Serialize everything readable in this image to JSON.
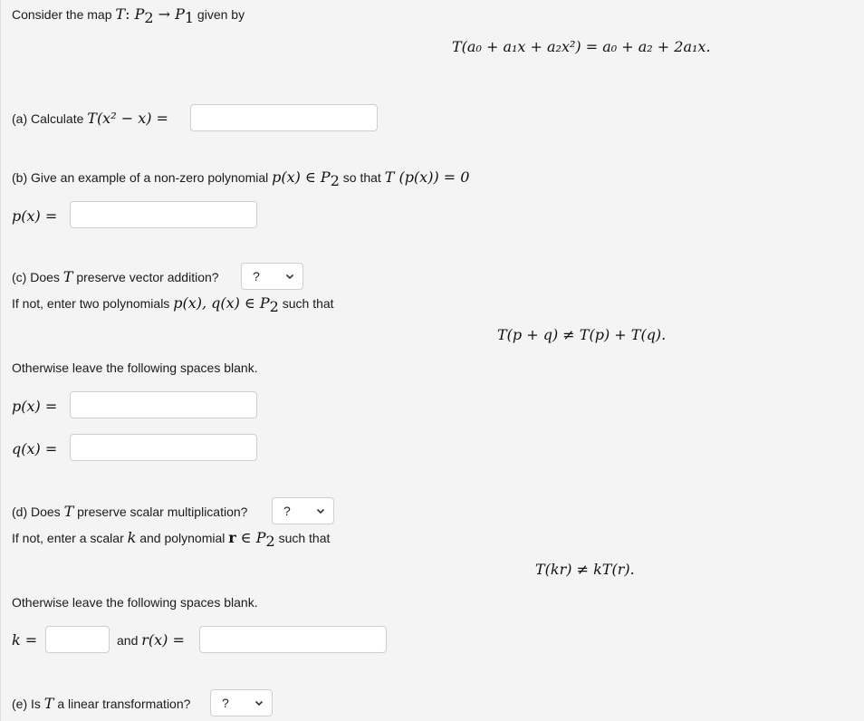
{
  "intro": {
    "prefix": "Consider the map ",
    "map_T": "T",
    "map_colon": ": ",
    "domain": "P",
    "domain_sub": "2",
    "arrow": " → ",
    "codomain": "P",
    "codomain_sub": "1",
    "suffix": " given by"
  },
  "definition": {
    "lhs": "T(a₀ + a₁x + a₂x²)",
    "rhs": "= a₀ + a₂ + 2a₁x."
  },
  "part_a": {
    "label": "(a) Calculate ",
    "expr": "T(x² − x) =",
    "input_value": ""
  },
  "part_b": {
    "label": "(b) Give an example of a non-zero polynomial ",
    "expr1": "p(x) ∈ ",
    "space": "P",
    "space_sub": "2",
    "mid": " so that ",
    "expr2": "T (p(x)) = 0",
    "answer_label": "p(x) =",
    "input_value": ""
  },
  "part_c": {
    "question_prefix": "(c) Does ",
    "question_T": "T",
    "question_suffix": " preserve vector addition?",
    "select_value": "?",
    "instruction_prefix": "If not, enter two polynomials ",
    "instruction_expr": "p(x), q(x) ∈ ",
    "instruction_space": "P",
    "instruction_space_sub": "2",
    "instruction_suffix": " such that",
    "condition": "T(p + q) ≠ T(p) + T(q).",
    "otherwise": "Otherwise leave the following spaces blank.",
    "p_label": "p(x) =",
    "q_label": "q(x) =",
    "p_value": "",
    "q_value": ""
  },
  "part_d": {
    "question_prefix": "(d) Does ",
    "question_T": "T",
    "question_suffix": " preserve scalar multiplication?",
    "select_value": "?",
    "instruction_prefix": "If not, enter a scalar ",
    "instruction_k": "k",
    "instruction_mid": " and polynomial ",
    "instruction_r": "r",
    "instruction_in": " ∈ ",
    "instruction_space": "P",
    "instruction_space_sub": "2",
    "instruction_suffix": " such that",
    "condition": "T(kr) ≠ kT(r).",
    "otherwise": "Otherwise leave the following spaces blank.",
    "k_label": "k =",
    "and_text": "and ",
    "r_label": "r(x) =",
    "k_value": "",
    "r_value": ""
  },
  "part_e": {
    "question_prefix": "(e) Is ",
    "question_T": "T",
    "question_suffix": " a linear transformation?",
    "select_value": "?"
  }
}
